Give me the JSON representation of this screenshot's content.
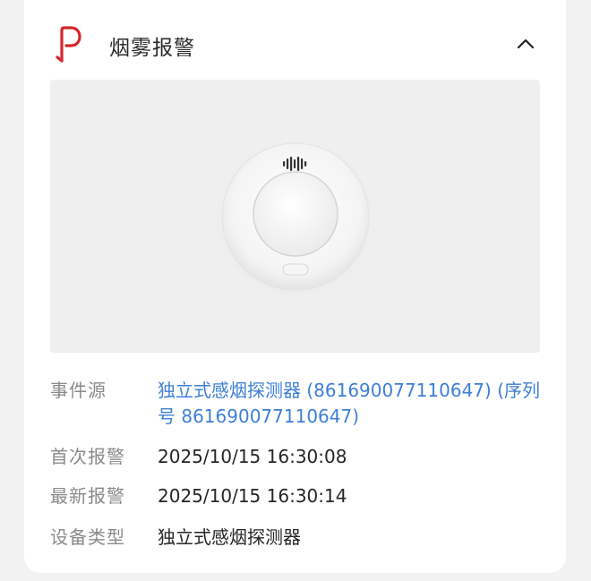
{
  "card": {
    "title": "烟雾报警",
    "brand_icon": "p-logo-icon",
    "collapse_icon": "chevron-up-icon",
    "accent_color": "#d8252b"
  },
  "device_image": {
    "subject": "smoke-detector"
  },
  "details": [
    {
      "label": "事件源",
      "value": "独立式感烟探测器 (861690077110647) (序列号 861690077110647)",
      "link": true
    },
    {
      "label": "首次报警",
      "value": "2025/10/15 16:30:08",
      "link": false
    },
    {
      "label": "最新报警",
      "value": "2025/10/15 16:30:14",
      "link": false
    },
    {
      "label": "设备类型",
      "value": "独立式感烟探测器",
      "link": false
    }
  ],
  "colors": {
    "link": "#3d7fd6",
    "label": "#8a8a8a",
    "text": "#262626"
  }
}
